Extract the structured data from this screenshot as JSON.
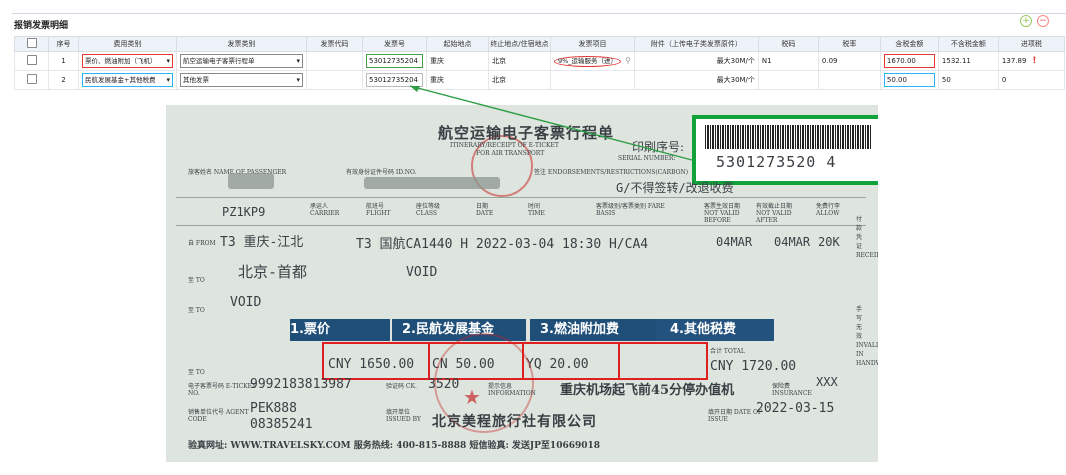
{
  "page": {
    "title": "报销发票明细",
    "add_icon": "plus-circle-icon",
    "remove_icon": "minus-circle-icon"
  },
  "table": {
    "headers": [
      "序号",
      "费用类别",
      "发票类别",
      "发票代码",
      "发票号",
      "起始地点",
      "终止地点/住宿地点",
      "发票项目",
      "附件（上传电子类发票原件）",
      "税码",
      "税率",
      "含税金额",
      "不含税金额",
      "进项税"
    ],
    "rows": [
      {
        "index": "1",
        "expense_type": "票价、燃油附加（飞机）",
        "invoice_type": "航空运输电子客票行程单",
        "invoice_code": "",
        "invoice_no": "53012735204",
        "start": "重庆",
        "end": "北京",
        "item": "9%_运输服务（进）",
        "attachment": "最大30M/个",
        "tax_code": "N1",
        "tax_rate": "0.09",
        "amount_incl": "1670.00",
        "amount_excl": "1532.11",
        "input_tax": "137.89",
        "warn": "!"
      },
      {
        "index": "2",
        "expense_type": "民航发展基金+其他税费",
        "invoice_type": "其他发票",
        "invoice_code": "",
        "invoice_no": "53012735204",
        "start": "重庆",
        "end": "北京",
        "item": "",
        "attachment": "最大30M/个",
        "tax_code": "",
        "tax_rate": "",
        "amount_incl": "50.00",
        "amount_excl": "50",
        "input_tax": "0"
      }
    ]
  },
  "receipt": {
    "title": "航空运输电子客票行程单",
    "subtitle_en1": "ITINERARY/RECEIPT OF E-TICKET",
    "subtitle_en2": "FOR AIR TRANSPORT",
    "print_no_label": "印刷序号:",
    "serial_label": "SERIAL NUMBER:",
    "serial_number": "5301273520 4",
    "passenger_label": "旅客姓名 NAME OF PASSENGER",
    "id_label": "有效身份证件号码 ID.NO.",
    "endorse_label": "签注 ENDORSEMENTS/RESTRICTIONS(CARBON)",
    "endorse_value": "G/不得签转/改退收费",
    "pnr": "PZ1KP9",
    "carrier_label": "承运人 CARRIER",
    "flight_label": "航班号 FLIGHT",
    "class_label": "座位等级 CLASS",
    "date_label": "日期 DATE",
    "time_label": "时间 TIME",
    "fare_basis_label": "客票级别/客票类别 FARE BASIS",
    "nvb_label": "客票生效日期 NOT VALID BEFORE",
    "nva_label": "有效截止日期 NOT VALID AFTER",
    "allow_label": "免费行李 ALLOW",
    "from_label": "自 FROM",
    "from_value": "T3 重庆-江北",
    "segment1": "T3 国航CA1440 H 2022-03-04 18:30 H/CA4",
    "nvb_value": "04MAR",
    "nva_value": "04MAR",
    "allow_value": "20K",
    "to_label": "至 TO",
    "to1_value": "北京-首都",
    "void1": "VOID",
    "void2": "VOID",
    "banner1": "1.票价",
    "banner2": "2.民航发展基金",
    "banner3": "3.燃油附加费",
    "banner4": "4.其他税费",
    "fare_value": "CNY 1650.00",
    "fund_value": "CN  50.00",
    "fuel_value": "YQ  20.00",
    "total_label": "合计 TOTAL",
    "total_value": "CNY     1720.00",
    "eticket_label": "电子客票号码 E-TICKET NO.",
    "eticket_value": "9992183813987",
    "ck_label": "验证码 CK.",
    "ck_value": "3520",
    "info_label": "提示信息 INFORMATION",
    "info_value": "重庆机场起飞前45分停办值机",
    "insurance_label": "保险费 INSURANCE",
    "insurance_value": "XXX",
    "agent_label": "销售单位代号 AGENT CODE",
    "agent_value": "PEK888",
    "agent_value2": "08385241",
    "issued_label": "填开单位 ISSUED BY",
    "issued_value": "北京美程旅行社有限公司",
    "date_issue_label": "填开日期 DATE OF ISSUE",
    "date_issue_value": "2022-03-15",
    "footer": "验真网址: WWW.TRAVELSKY.COM  服务热线: 400-815-8888  短信验真: 发送JP至10669018",
    "side_text": "付款凭证 RECEIPT",
    "side_text2": "手写无效 INVALID IN HANDWRITING"
  },
  "colors": {
    "red_box": "#e53935",
    "green_box": "#43a047",
    "blue_box": "#29b6f6",
    "banner": "#1f4e79"
  }
}
